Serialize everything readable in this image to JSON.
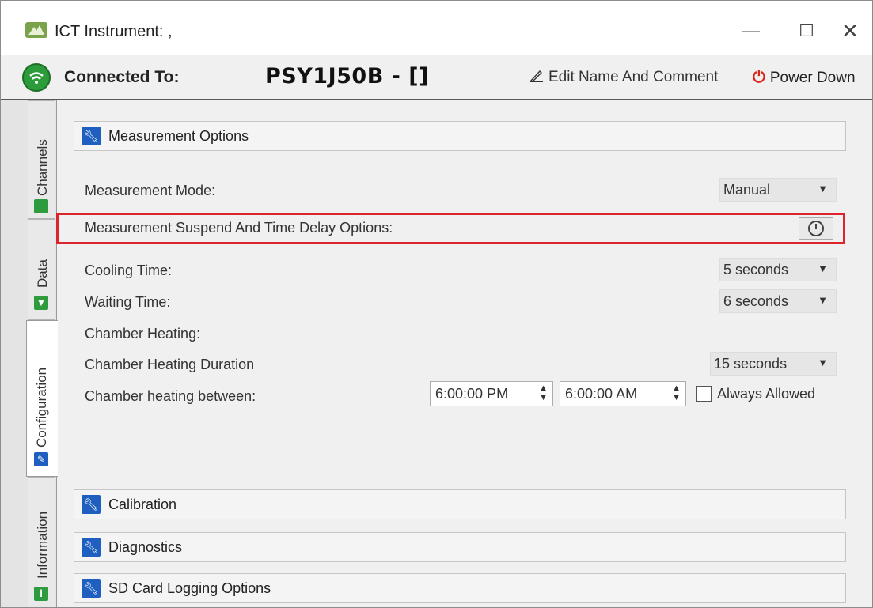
{
  "window": {
    "title": "ICT Instrument: ,",
    "minimize_glyph": "—",
    "maximize_glyph": "☐",
    "close_glyph": "✕"
  },
  "header": {
    "connected_label": "Connected To:",
    "device_name": "PSY1J50B - []",
    "edit_label": "Edit Name And Comment",
    "power_label": "Power Down",
    "connection_status_color": "#2c9c3a",
    "power_color": "#d9251d"
  },
  "side_tabs": [
    {
      "label": "Channels",
      "icon": "channels-icon",
      "color": "#2e9c3e"
    },
    {
      "label": "Data",
      "icon": "download-icon",
      "color": "#2e9c3e"
    },
    {
      "label": "Configuration",
      "icon": "wrench-icon",
      "color": "#1f5fbf",
      "active": true
    },
    {
      "label": "Information",
      "icon": "info-icon",
      "color": "#2e9c3e"
    }
  ],
  "measurement_options": {
    "title": "Measurement Options",
    "mode_label": "Measurement Mode:",
    "mode_value": "Manual",
    "suspend_label": "Measurement Suspend And Time Delay Options:",
    "cooling_label": "Cooling Time:",
    "cooling_value": "5 seconds",
    "waiting_label": "Waiting Time:",
    "waiting_value": "6 seconds",
    "heating_label": "Chamber Heating:",
    "heating_duration_label": "Chamber Heating Duration",
    "heating_duration_value": "15 seconds",
    "heating_between_label": "Chamber heating between:",
    "heating_start": "6:00:00 PM",
    "heating_end": "6:00:00 AM",
    "always_allowed_label": "Always Allowed",
    "always_allowed_checked": false,
    "highlight_color": "#d9252b"
  },
  "collapsed_sections": [
    {
      "title": "Calibration"
    },
    {
      "title": "Diagnostics"
    },
    {
      "title": "SD Card Logging Options"
    }
  ]
}
